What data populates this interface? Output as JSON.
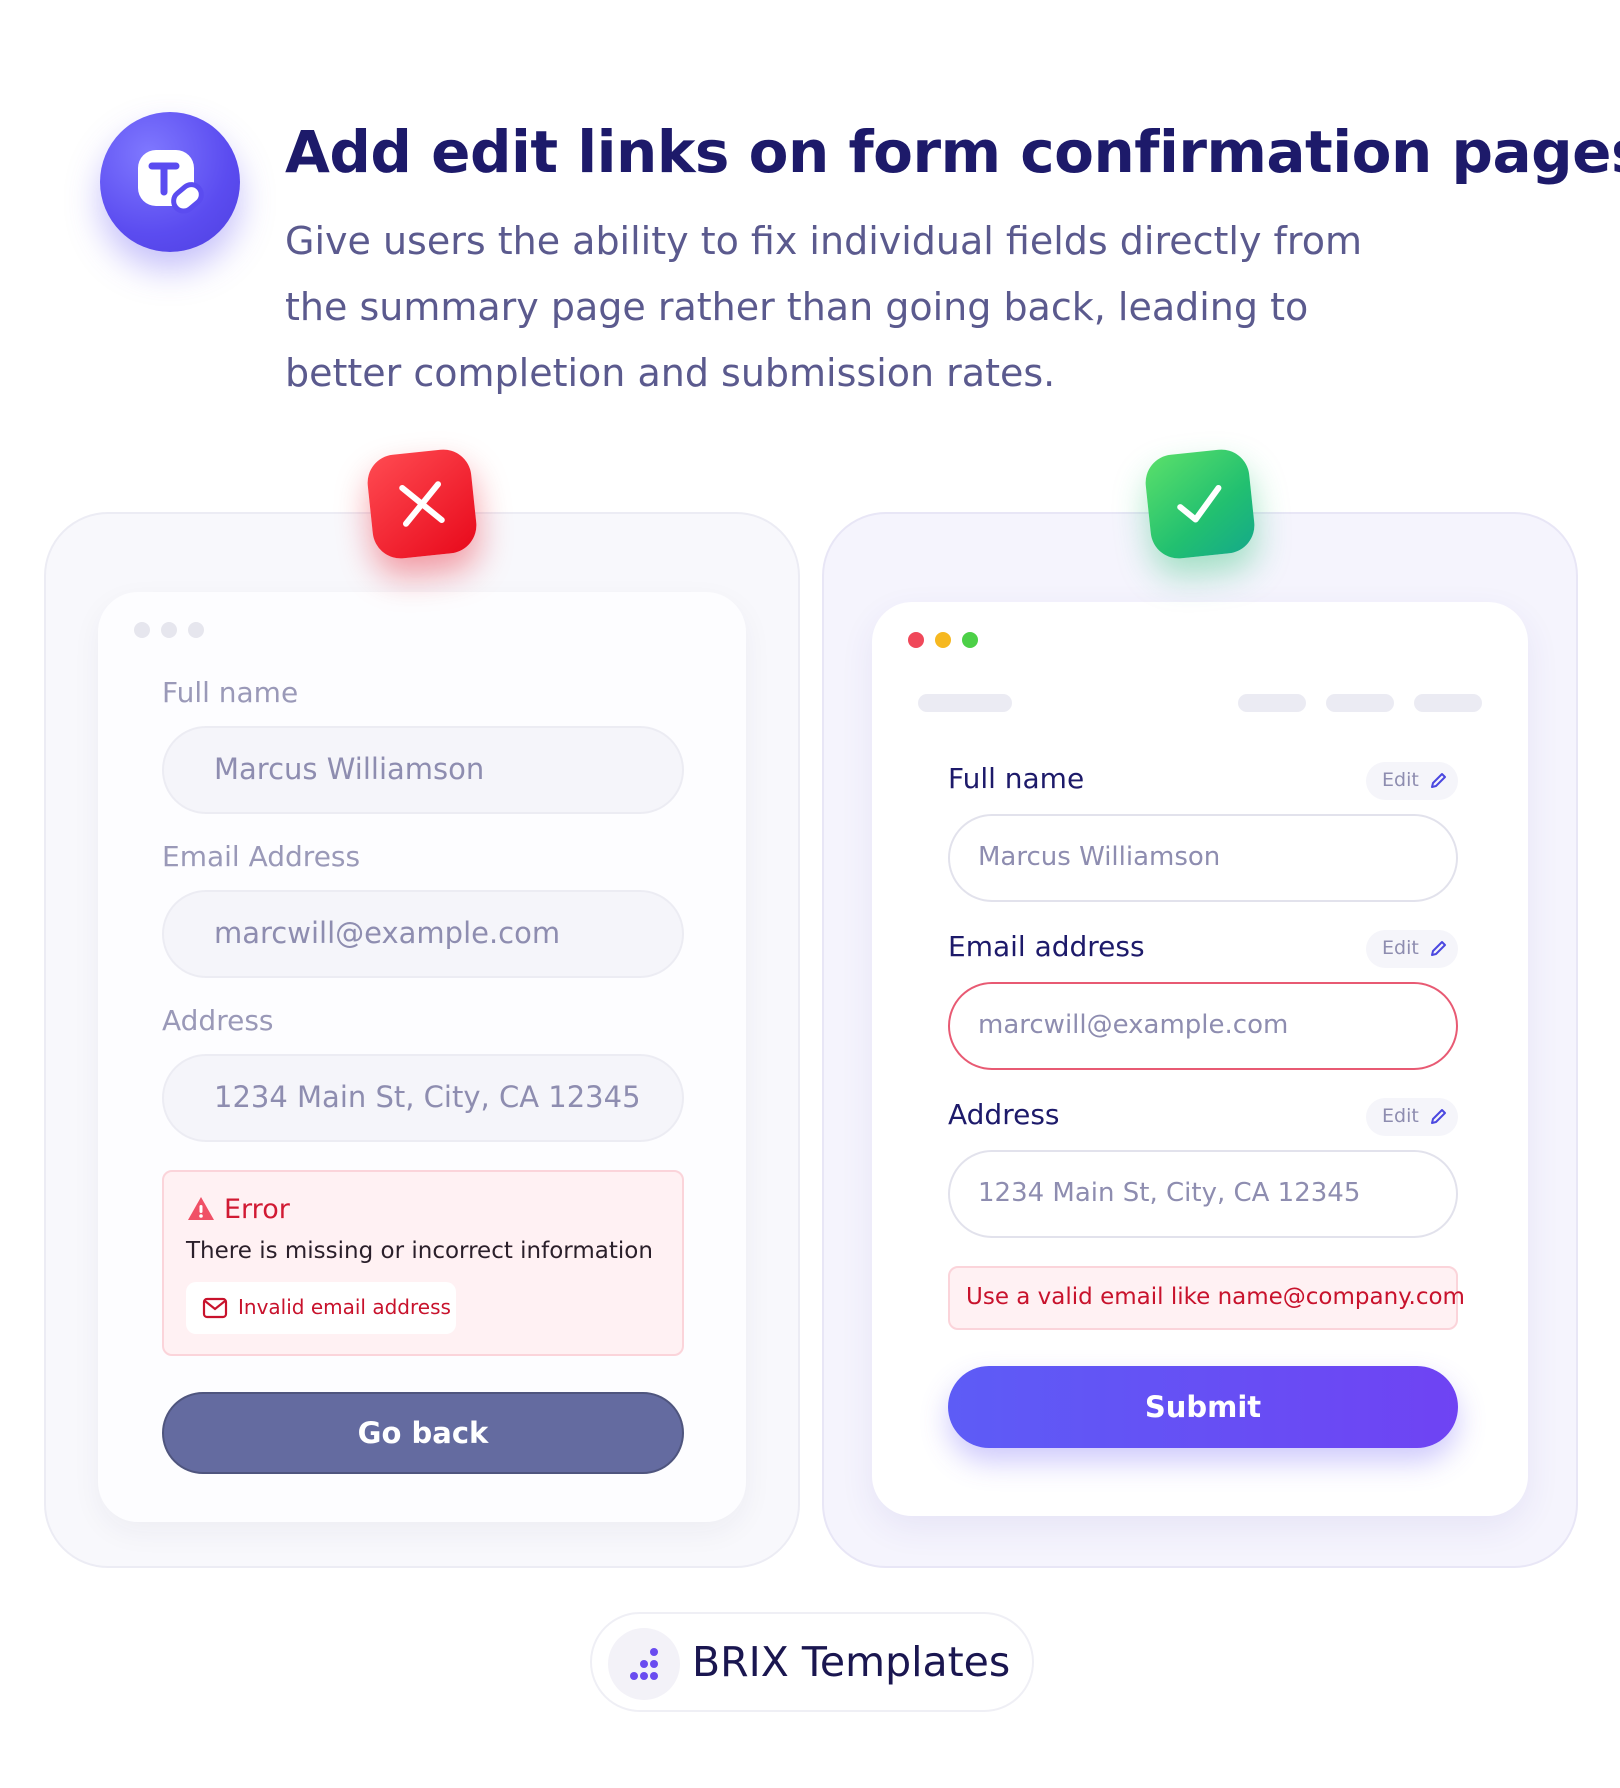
{
  "header": {
    "icon": "text-edit-icon",
    "title": "Add edit links on form confirmation pages",
    "subtitle": "Give users the ability to fix individual fields directly from the summary page rather than going back, leading to better completion and submission rates."
  },
  "bad_example": {
    "badge_icon": "close-icon",
    "fields": [
      {
        "label": "Full name",
        "value": "Marcus Williamson"
      },
      {
        "label": "Email Address",
        "value": "marcwill@example.com"
      },
      {
        "label": "Address",
        "value": "1234 Main St, City, CA 12345"
      }
    ],
    "error": {
      "title": "Error",
      "message": "There is missing or incorrect information",
      "chip": "Invalid email address"
    },
    "button": "Go back"
  },
  "good_example": {
    "badge_icon": "check-icon",
    "window_dots": [
      "#f0485a",
      "#f6b820",
      "#4cd047"
    ],
    "edit_label": "Edit",
    "fields": [
      {
        "label": "Full name",
        "value": "Marcus Williamson"
      },
      {
        "label": "Email address",
        "value": "marcwill@example.com"
      },
      {
        "label": "Address",
        "value": "1234 Main St, City, CA 12345"
      }
    ],
    "hint": "Use a valid email like name@company.com",
    "button": "Submit"
  },
  "footer": {
    "brand": "BRIX Templates"
  },
  "colors": {
    "accent": "#5d5cf6",
    "error": "#c8122c",
    "success": "#22c070",
    "title": "#1d1a6a"
  }
}
